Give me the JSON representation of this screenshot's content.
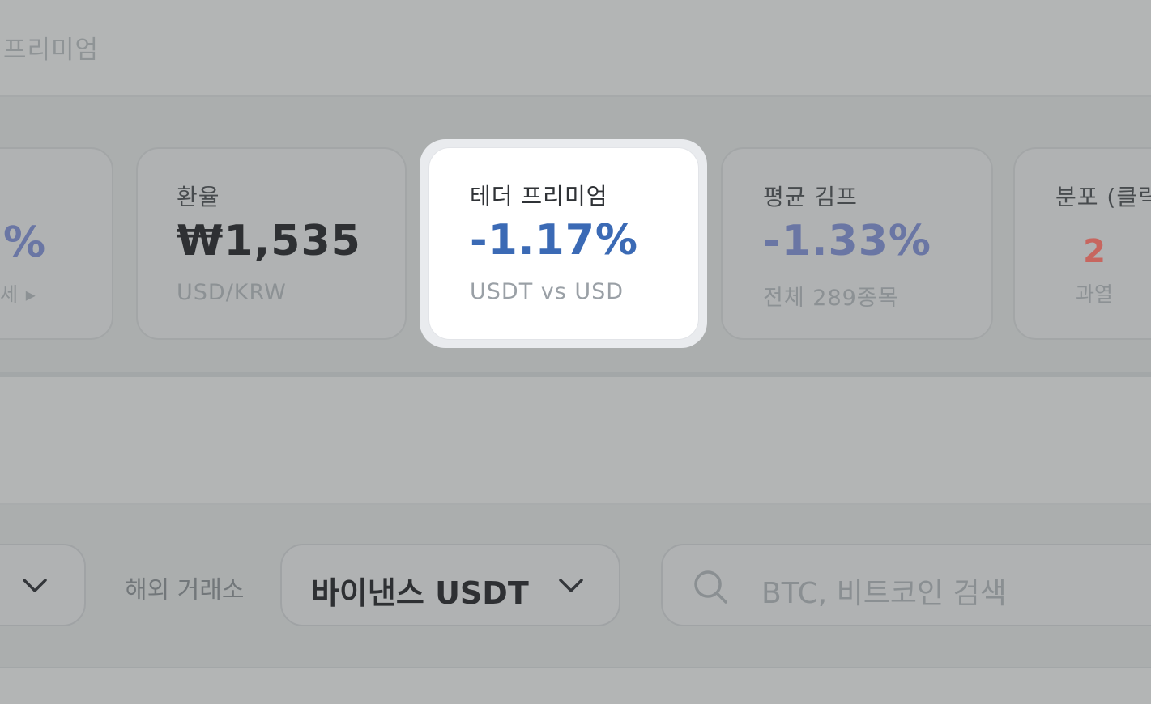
{
  "header": {
    "title_partial": "프리미엄"
  },
  "stats": {
    "card1": {
      "value_partial": "%",
      "sub_partial": "세 ▸"
    },
    "card2": {
      "title": "환율",
      "value": "₩1,535",
      "sub": "USD/KRW"
    },
    "card3": {
      "title": "테더 프리미엄",
      "value": "-1.17%",
      "sub": "USDT vs USD"
    },
    "card4": {
      "title": "평균 김프",
      "value": "-1.33%",
      "sub": "전체 289종목"
    },
    "card5": {
      "title_partial": "분포 (클릭",
      "value": "2",
      "sub": "과열"
    }
  },
  "filters": {
    "overseas_label": "해외 거래소",
    "overseas_value": "바이낸스 USDT",
    "search_placeholder": "BTC, 비트코인 검색"
  },
  "colors": {
    "highlight_value": "#3b6ab5",
    "dim_blue": "#6a76a4",
    "overheat_red": "#c7665f"
  }
}
